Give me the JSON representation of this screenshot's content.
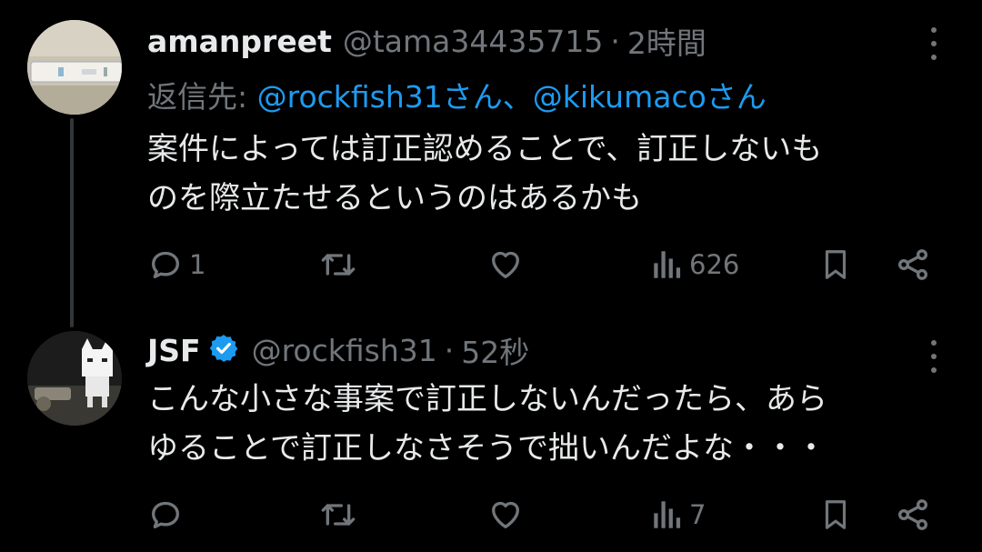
{
  "tweets": [
    {
      "name": "amanpreet",
      "handle": "@tama34435715",
      "time": "2時間",
      "reply_prefix": "返信先: ",
      "reply_mentions": [
        "@rockfish31さん",
        "@kikumacoさん"
      ],
      "reply_separator": "、",
      "lines": [
        "案件によっては訂正認めることで、訂正しないも",
        "のを際立たせるというのはあるかも"
      ],
      "replies": "1",
      "retweets": "",
      "likes": "",
      "views": "626",
      "verified": false
    },
    {
      "name": "JSF",
      "handle": "@rockfish31",
      "time": "52秒",
      "lines": [
        "こんな小さな事案で訂正しないんだったら、あら",
        "ゆることで訂正しなさそうで拙いんだよな・・・"
      ],
      "replies": "",
      "retweets": "",
      "likes": "",
      "views": "7",
      "verified": true
    }
  ],
  "colors": {
    "background": "#000000",
    "text": "#e7e9ea",
    "secondary": "#71767b",
    "link": "#1d9bf0",
    "verified": "#1d9bf0"
  },
  "icons": [
    "reply-icon",
    "retweet-icon",
    "like-icon",
    "views-icon",
    "bookmark-icon",
    "share-icon",
    "more-icon",
    "verified-badge-icon"
  ]
}
